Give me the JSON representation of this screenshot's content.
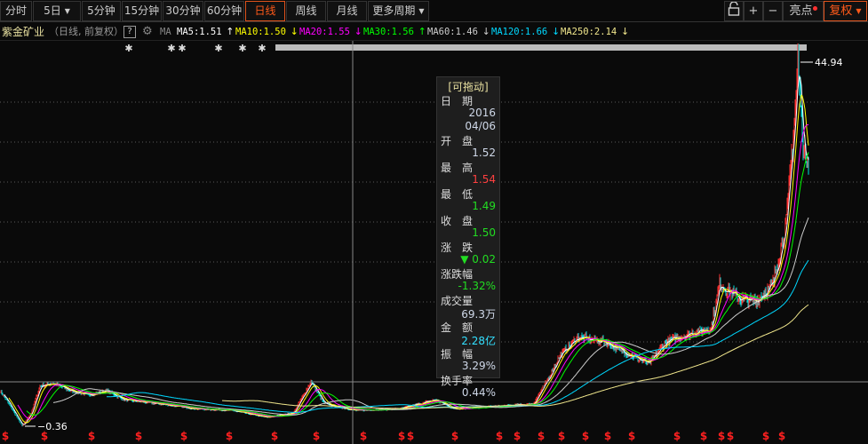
{
  "toolbar": {
    "periods": [
      "分时",
      "5日",
      "5分钟",
      "15分钟",
      "30分钟",
      "60分钟",
      "日线",
      "周线",
      "月线",
      "更多周期"
    ],
    "active": "日线",
    "right": {
      "lock_icon": "unlock-icon",
      "zoom_in": "+",
      "zoom_out": "−",
      "highlights": "亮点",
      "adjust": "复权"
    }
  },
  "ma_row": {
    "stock_name": "紫金矿业",
    "mode": "（日线, 前复权）",
    "help": "?",
    "ma_label": "MA",
    "items": [
      {
        "label": "MA5:1.51",
        "arrow": "↑",
        "color": "#ffffff"
      },
      {
        "label": "MA10:1.50",
        "arrow": "↓",
        "color": "#ffff00"
      },
      {
        "label": "MA20:1.55",
        "arrow": "↓",
        "color": "#ff00ff"
      },
      {
        "label": "MA30:1.56",
        "arrow": "↑",
        "color": "#00ff00"
      },
      {
        "label": "MA60:1.46",
        "arrow": "↓",
        "color": "#cccccc"
      },
      {
        "label": "MA120:1.66",
        "arrow": "↓",
        "color": "#00d8ff"
      },
      {
        "label": "MA250:2.14",
        "arrow": "↓",
        "color": "#f0e68c"
      }
    ]
  },
  "tooltip": {
    "title": "[可拖动]",
    "rows": [
      {
        "k": "日　期",
        "v": "2016",
        "v2": "04/06",
        "color": "#cfd8e8"
      },
      {
        "k": "开　盘",
        "v": "1.52",
        "color": "#cfd8e8"
      },
      {
        "k": "最　高",
        "v": "1.54",
        "color": "#ff4040"
      },
      {
        "k": "最　低",
        "v": "1.49",
        "color": "#22dd22"
      },
      {
        "k": "收　盘",
        "v": "1.50",
        "color": "#22dd22"
      },
      {
        "k": "涨　跌",
        "v": "▼ 0.02",
        "color": "#22dd22"
      },
      {
        "k": "涨跌幅",
        "v": "-1.32%",
        "color": "#22dd22"
      },
      {
        "k": "成交量",
        "v": "69.3万",
        "color": "#cfd8e8"
      },
      {
        "k": "金　额",
        "v": "2.28亿",
        "color": "#33e0ff"
      },
      {
        "k": "振　幅",
        "v": "3.29%",
        "color": "#cfd8e8"
      },
      {
        "k": "换手率",
        "v": "0.44%",
        "color": "#cfd8e8"
      }
    ]
  },
  "chart_data": {
    "type": "candlestick",
    "title": "紫金矿业 日线 前复权",
    "high_label": "44.94",
    "low_label": "0.36",
    "ylim": [
      0.36,
      44.94
    ],
    "x_range": [
      0,
      910
    ],
    "price_keypoints": [
      [
        0,
        4.8
      ],
      [
        10,
        3.2
      ],
      [
        25,
        0.47
      ],
      [
        35,
        2.1
      ],
      [
        45,
        5.4
      ],
      [
        60,
        5.7
      ],
      [
        80,
        4.8
      ],
      [
        100,
        4.3
      ],
      [
        120,
        4.8
      ],
      [
        140,
        3.7
      ],
      [
        180,
        3.2
      ],
      [
        220,
        2.6
      ],
      [
        260,
        2.4
      ],
      [
        300,
        1.55
      ],
      [
        330,
        2.1
      ],
      [
        350,
        5.9
      ],
      [
        365,
        3.2
      ],
      [
        400,
        2.4
      ],
      [
        450,
        2.6
      ],
      [
        490,
        3.7
      ],
      [
        510,
        2.6
      ],
      [
        560,
        2.9
      ],
      [
        600,
        3.2
      ],
      [
        615,
        5.9
      ],
      [
        630,
        9.1
      ],
      [
        650,
        11.3
      ],
      [
        680,
        10.8
      ],
      [
        700,
        9.7
      ],
      [
        730,
        8.1
      ],
      [
        750,
        10.8
      ],
      [
        780,
        11.9
      ],
      [
        800,
        12.4
      ],
      [
        810,
        17.8
      ],
      [
        830,
        16.2
      ],
      [
        850,
        15.7
      ],
      [
        870,
        17.8
      ],
      [
        885,
        25.4
      ],
      [
        895,
        39.5
      ],
      [
        898,
        44.94
      ],
      [
        905,
        33.6
      ]
    ],
    "ma_periods": [
      5,
      10,
      20,
      30,
      60,
      120,
      250
    ],
    "s_marker_days": [
      6,
      50,
      103,
      156,
      207,
      258,
      309,
      356,
      409,
      452,
      462,
      512,
      562,
      582,
      609,
      632,
      659,
      684,
      711,
      762,
      792,
      812,
      822,
      862,
      880
    ],
    "star_marker_days": [
      145,
      193,
      205,
      246,
      273,
      295
    ]
  },
  "colors": {
    "up": "#ff3030",
    "down": "#00e0e0",
    "grid": "#5a5a5a"
  }
}
